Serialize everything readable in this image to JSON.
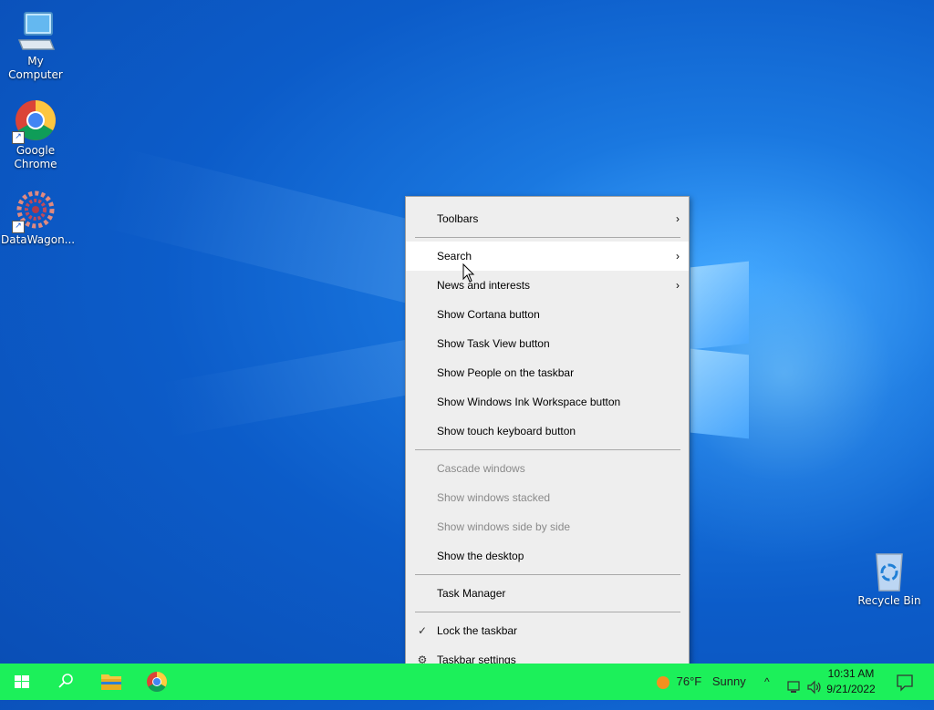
{
  "desktop": {
    "icons": [
      {
        "label": "My Computer",
        "icon": "computer-icon"
      },
      {
        "label": "Google Chrome",
        "icon": "chrome-icon"
      },
      {
        "label": "DataWagon...",
        "icon": "datawagon-icon"
      },
      {
        "label": "Recycle Bin",
        "icon": "recycle-bin-icon"
      }
    ]
  },
  "context_menu": {
    "items": [
      {
        "label": "Toolbars",
        "submenu": true
      },
      {
        "label": "Search",
        "submenu": true,
        "hover": true
      },
      {
        "label": "News and interests",
        "submenu": true
      },
      {
        "label": "Show Cortana button"
      },
      {
        "label": "Show Task View button"
      },
      {
        "label": "Show People on the taskbar"
      },
      {
        "label": "Show Windows Ink Workspace button"
      },
      {
        "label": "Show touch keyboard button"
      },
      {
        "label": "Cascade windows",
        "disabled": true
      },
      {
        "label": "Show windows stacked",
        "disabled": true
      },
      {
        "label": "Show windows side by side",
        "disabled": true
      },
      {
        "label": "Show the desktop"
      },
      {
        "label": "Task Manager"
      },
      {
        "label": "Lock the taskbar",
        "checked": true
      },
      {
        "label": "Taskbar settings",
        "icon": "gear-icon"
      }
    ],
    "arrow_glyph": "›",
    "check_glyph": "✓",
    "gear_glyph": "⚙"
  },
  "taskbar": {
    "color": "#1cf05a",
    "weather": {
      "temp": "76°F",
      "condition": "Sunny"
    },
    "clock": {
      "time": "10:31 AM",
      "date": "9/21/2022"
    },
    "tray_chevron": "^"
  }
}
